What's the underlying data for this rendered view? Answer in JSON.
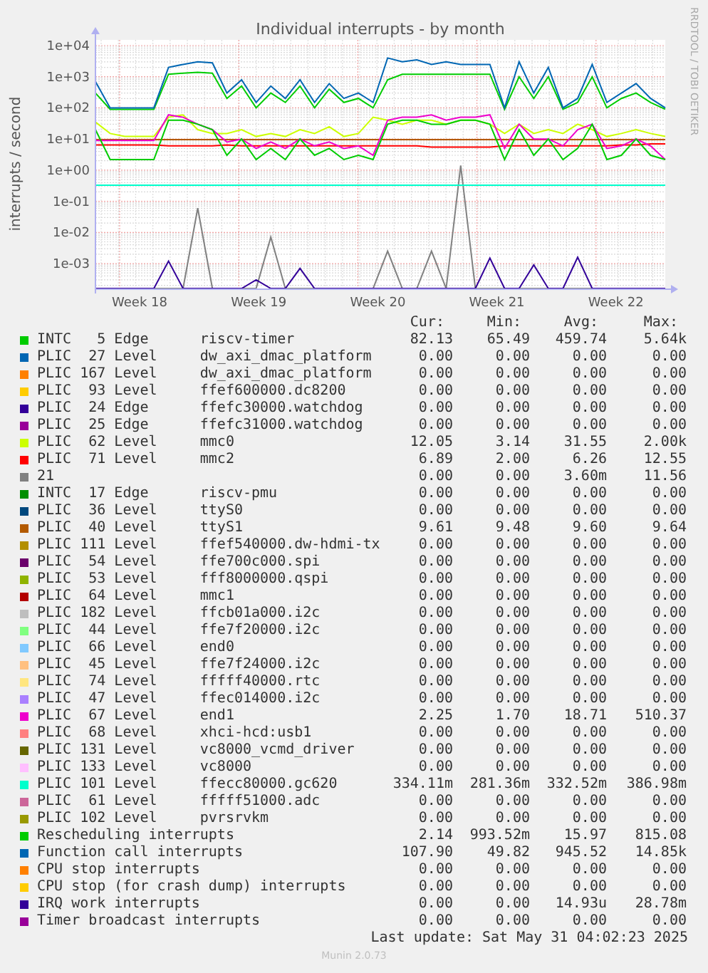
{
  "graph": {
    "title": "Individual interrupts - by month",
    "ylabel": "interrupts / second",
    "side_credit": "RRDTOOL / TOBI OETIKER",
    "y_ticks": [
      "1e+04",
      "1e+03",
      "1e+02",
      "1e+01",
      "1e+00",
      "1e-01",
      "1e-02",
      "1e-03"
    ],
    "x_ticks": [
      "Week 18",
      "Week 19",
      "Week 20",
      "Week 21",
      "Week 22"
    ]
  },
  "legend": {
    "headers": [
      "Cur:",
      "Min:",
      "Avg:",
      "Max:"
    ],
    "rows": [
      {
        "label": "INTC   5 Edge      riscv-timer",
        "color": "#00cc00",
        "cur": "82.13",
        "min": "65.49",
        "avg": "459.74",
        "max": "5.64k"
      },
      {
        "label": "PLIC  27 Level     dw_axi_dmac_platform",
        "color": "#0066b3",
        "cur": "0.00",
        "min": "0.00",
        "avg": "0.00",
        "max": "0.00"
      },
      {
        "label": "PLIC 167 Level     dw_axi_dmac_platform",
        "color": "#ff8000",
        "cur": "0.00",
        "min": "0.00",
        "avg": "0.00",
        "max": "0.00"
      },
      {
        "label": "PLIC  93 Level     ffef600000.dc8200",
        "color": "#ffcc00",
        "cur": "0.00",
        "min": "0.00",
        "avg": "0.00",
        "max": "0.00"
      },
      {
        "label": "PLIC  24 Edge      ffefc30000.watchdog",
        "color": "#330099",
        "cur": "0.00",
        "min": "0.00",
        "avg": "0.00",
        "max": "0.00"
      },
      {
        "label": "PLIC  25 Edge      ffefc31000.watchdog",
        "color": "#990099",
        "cur": "0.00",
        "min": "0.00",
        "avg": "0.00",
        "max": "0.00"
      },
      {
        "label": "PLIC  62 Level     mmc0",
        "color": "#ccff00",
        "cur": "12.05",
        "min": "3.14",
        "avg": "31.55",
        "max": "2.00k"
      },
      {
        "label": "PLIC  71 Level     mmc2",
        "color": "#ff0000",
        "cur": "6.89",
        "min": "2.00",
        "avg": "6.26",
        "max": "12.55"
      },
      {
        "label": "21",
        "color": "#808080",
        "cur": "0.00",
        "min": "0.00",
        "avg": "3.60m",
        "max": "11.56"
      },
      {
        "label": "INTC  17 Edge      riscv-pmu",
        "color": "#008f00",
        "cur": "0.00",
        "min": "0.00",
        "avg": "0.00",
        "max": "0.00"
      },
      {
        "label": "PLIC  36 Level     ttyS0",
        "color": "#00487d",
        "cur": "0.00",
        "min": "0.00",
        "avg": "0.00",
        "max": "0.00"
      },
      {
        "label": "PLIC  40 Level     ttyS1",
        "color": "#b35a00",
        "cur": "9.61",
        "min": "9.48",
        "avg": "9.60",
        "max": "9.64"
      },
      {
        "label": "PLIC 111 Level     ffef540000.dw-hdmi-tx",
        "color": "#b38f00",
        "cur": "0.00",
        "min": "0.00",
        "avg": "0.00",
        "max": "0.00"
      },
      {
        "label": "PLIC  54 Level     ffe700c000.spi",
        "color": "#6b006b",
        "cur": "0.00",
        "min": "0.00",
        "avg": "0.00",
        "max": "0.00"
      },
      {
        "label": "PLIC  53 Level     fff8000000.qspi",
        "color": "#8fb300",
        "cur": "0.00",
        "min": "0.00",
        "avg": "0.00",
        "max": "0.00"
      },
      {
        "label": "PLIC  64 Level     mmc1",
        "color": "#b30000",
        "cur": "0.00",
        "min": "0.00",
        "avg": "0.00",
        "max": "0.00"
      },
      {
        "label": "PLIC 182 Level     ffcb01a000.i2c",
        "color": "#bebebe",
        "cur": "0.00",
        "min": "0.00",
        "avg": "0.00",
        "max": "0.00"
      },
      {
        "label": "PLIC  44 Level     ffe7f20000.i2c",
        "color": "#80ff80",
        "cur": "0.00",
        "min": "0.00",
        "avg": "0.00",
        "max": "0.00"
      },
      {
        "label": "PLIC  66 Level     end0",
        "color": "#80c9ff",
        "cur": "0.00",
        "min": "0.00",
        "avg": "0.00",
        "max": "0.00"
      },
      {
        "label": "PLIC  45 Level     ffe7f24000.i2c",
        "color": "#ffc080",
        "cur": "0.00",
        "min": "0.00",
        "avg": "0.00",
        "max": "0.00"
      },
      {
        "label": "PLIC  74 Level     fffff40000.rtc",
        "color": "#ffe680",
        "cur": "0.00",
        "min": "0.00",
        "avg": "0.00",
        "max": "0.00"
      },
      {
        "label": "PLIC  47 Level     ffec014000.i2c",
        "color": "#aa80ff",
        "cur": "0.00",
        "min": "0.00",
        "avg": "0.00",
        "max": "0.00"
      },
      {
        "label": "PLIC  67 Level     end1",
        "color": "#ee00cc",
        "cur": "2.25",
        "min": "1.70",
        "avg": "18.71",
        "max": "510.37"
      },
      {
        "label": "PLIC  68 Level     xhci-hcd:usb1",
        "color": "#ff8080",
        "cur": "0.00",
        "min": "0.00",
        "avg": "0.00",
        "max": "0.00"
      },
      {
        "label": "PLIC 131 Level     vc8000_vcmd_driver",
        "color": "#666600",
        "cur": "0.00",
        "min": "0.00",
        "avg": "0.00",
        "max": "0.00"
      },
      {
        "label": "PLIC 133 Level     vc8000",
        "color": "#ffbfff",
        "cur": "0.00",
        "min": "0.00",
        "avg": "0.00",
        "max": "0.00"
      },
      {
        "label": "PLIC 101 Level     ffecc80000.gc620",
        "color": "#00ffcc",
        "cur": "334.11m",
        "min": "281.36m",
        "avg": "332.52m",
        "max": "386.98m"
      },
      {
        "label": "PLIC  61 Level     fffff51000.adc",
        "color": "#cc6699",
        "cur": "0.00",
        "min": "0.00",
        "avg": "0.00",
        "max": "0.00"
      },
      {
        "label": "PLIC 102 Level     pvrsrvkm",
        "color": "#999900",
        "cur": "0.00",
        "min": "0.00",
        "avg": "0.00",
        "max": "0.00"
      },
      {
        "label": "Rescheduling interrupts",
        "color": "#00cc00",
        "cur": "2.14",
        "min": "993.52m",
        "avg": "15.97",
        "max": "815.08"
      },
      {
        "label": "Function call interrupts",
        "color": "#0066b3",
        "cur": "107.90",
        "min": "49.82",
        "avg": "945.52",
        "max": "14.85k"
      },
      {
        "label": "CPU stop interrupts",
        "color": "#ff8000",
        "cur": "0.00",
        "min": "0.00",
        "avg": "0.00",
        "max": "0.00"
      },
      {
        "label": "CPU stop (for crash dump) interrupts",
        "color": "#ffcc00",
        "cur": "0.00",
        "min": "0.00",
        "avg": "0.00",
        "max": "0.00"
      },
      {
        "label": "IRQ work interrupts",
        "color": "#330099",
        "cur": "0.00",
        "min": "0.00",
        "avg": "14.93u",
        "max": "28.78m"
      },
      {
        "label": "Timer broadcast interrupts",
        "color": "#990099",
        "cur": "0.00",
        "min": "0.00",
        "avg": "0.00",
        "max": "0.00"
      }
    ]
  },
  "last_update": "Last update: Sat May 31 04:02:23 2025",
  "footer": "Munin 2.0.73"
}
